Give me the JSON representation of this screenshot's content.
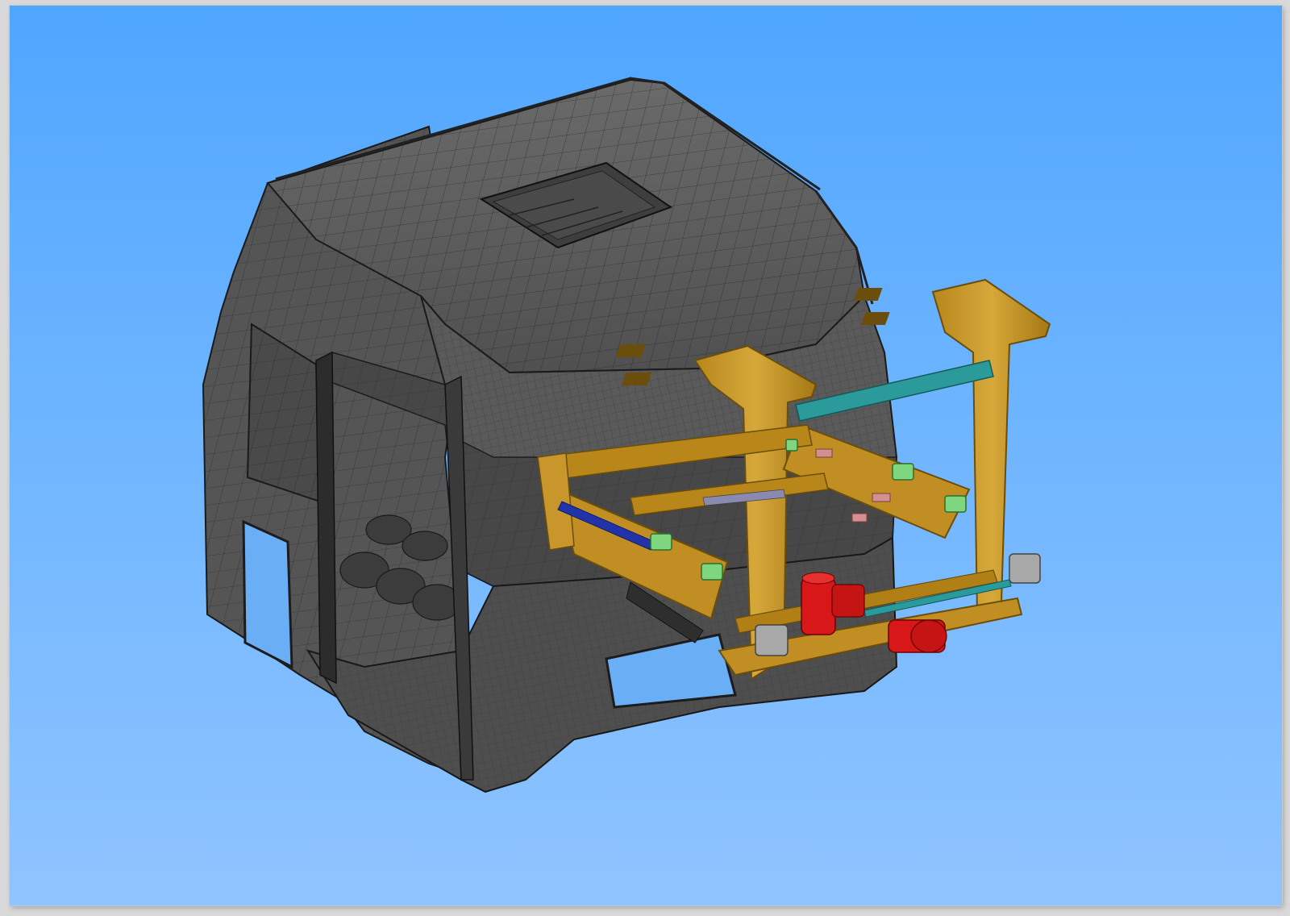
{
  "viewport": {
    "background_top": "#4fa6ff",
    "background_bottom": "#8fc4ff"
  },
  "model": {
    "cab_color": "#5c5c5c",
    "cab_line_color": "#1e1e1e",
    "frame_color": "#c89a2a",
    "frame_dark": "#8a6514",
    "rod_color": "#2a9a9a",
    "motor_color": "#d81818",
    "block_color": "#7ed67e",
    "screw_color": "#2233aa",
    "icons": [
      "truck-cab-model-icon",
      "lifting-frame-icon",
      "motor-icon"
    ]
  }
}
